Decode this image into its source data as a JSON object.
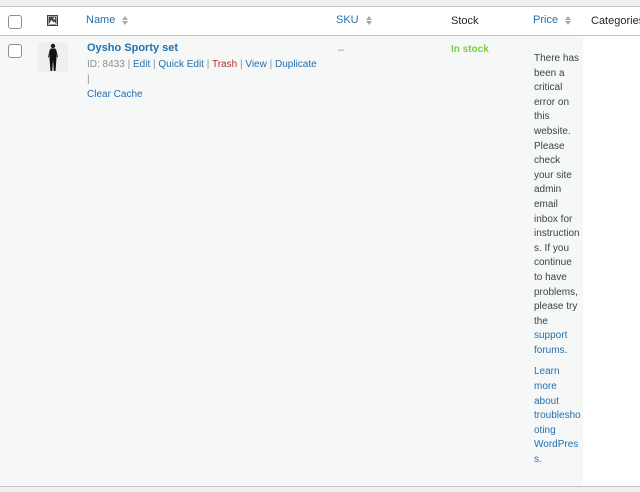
{
  "columns": {
    "name": "Name",
    "sku": "SKU",
    "stock": "Stock",
    "price": "Price",
    "categories": "Categories"
  },
  "product": {
    "title": "Oysho Sporty set",
    "id_label": "ID: 8433",
    "actions": {
      "edit": "Edit",
      "quick_edit": "Quick Edit",
      "trash": "Trash",
      "view": "View",
      "duplicate": "Duplicate",
      "clear_cache": "Clear Cache"
    },
    "separator": "|",
    "sku": "–",
    "stock": "In stock",
    "price_error": {
      "message": "There has been a critical error on this website. Please check your site admin email inbox for instructions. If you continue to have problems, please try the",
      "link1": "support forums",
      "after_link1": ".",
      "link2": "Learn more about troubleshooting WordPress."
    }
  },
  "colors": {
    "link": "#2271b1",
    "in_stock": "#7ad03a",
    "trash": "#b32d2e"
  },
  "icons": {
    "thumbnail_header": "image-icon",
    "sort": "sort-arrows-icon"
  }
}
